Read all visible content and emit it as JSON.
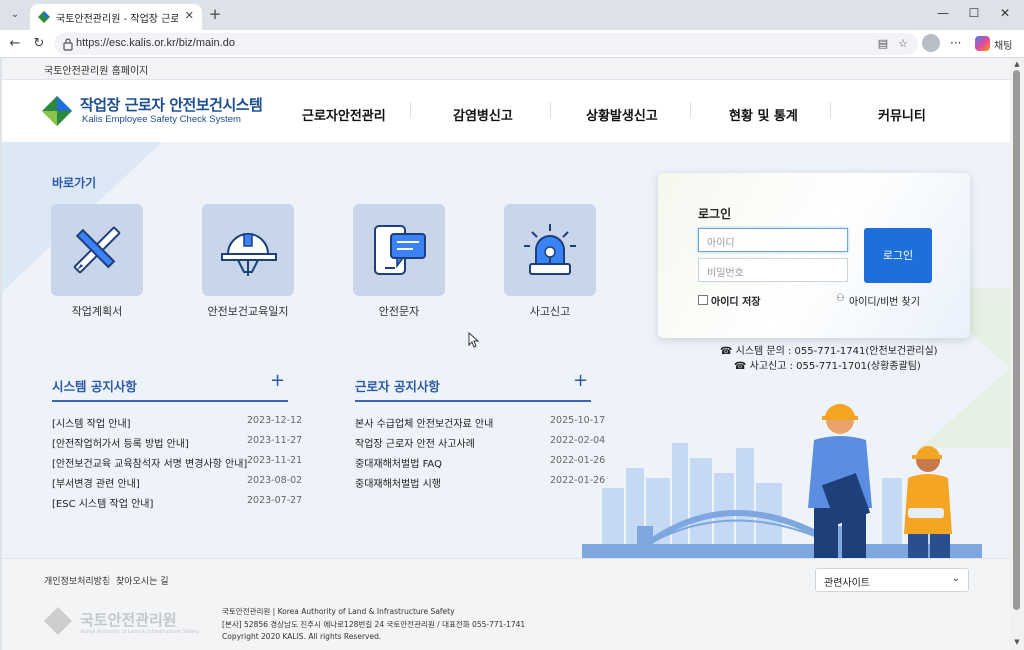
{
  "browser": {
    "tab_title": "국토안전관리원 - 작업장 근로자 안전보건시스템",
    "url": "https://esc.kalis.or.kr/biz/main.do",
    "chat_label": "채팅"
  },
  "site": {
    "top_link": "국토안전관리원 홈페이지",
    "logo_title": "작업장 근로자 안전보건시스템",
    "logo_subtitle": "Kalis Employee Safety Check System",
    "nav": [
      "근로자안전관리",
      "감염병신고",
      "상황발생신고",
      "현황 및 통계",
      "커뮤니티"
    ]
  },
  "quick_links": {
    "title": "바로가기",
    "items": [
      {
        "label": "작업계획서",
        "icon": "pencil-ruler-icon"
      },
      {
        "label": "안전보건교육일지",
        "icon": "hardhat-icon"
      },
      {
        "label": "안전문자",
        "icon": "phone-message-icon"
      },
      {
        "label": "사고신고",
        "icon": "siren-icon"
      }
    ]
  },
  "login": {
    "title": "로그인",
    "id_placeholder": "아이디",
    "pw_placeholder": "비밀번호",
    "button": "로그인",
    "save_id": "아이디 저장",
    "find": "아이디/비번 찾기"
  },
  "contacts": {
    "system": "☎ 시스템 문의 : 055-771-1741(안전보건관리실)",
    "accident": "☎ 사고신고 : 055-771-1701(상황종괄팀)"
  },
  "notices": {
    "system": {
      "title": "시스템 공지사항",
      "items": [
        {
          "title": "[시스템 작업 안내]",
          "date": "2023-12-12"
        },
        {
          "title": "[안전작업허가서 등록 방법 안내]",
          "date": "2023-11-27"
        },
        {
          "title": "[안전보건교육 교육참석자 서명 변경사항 안내]",
          "date": "2023-11-21"
        },
        {
          "title": "[부서변경 관련 안내]",
          "date": "2023-08-02"
        },
        {
          "title": "[ESC 시스템 작업 안내]",
          "date": "2023-07-27"
        }
      ]
    },
    "worker": {
      "title": "근로자 공지사항",
      "items": [
        {
          "title": "본사 수급업체 안전보건자료 안내",
          "date": "2025-10-17"
        },
        {
          "title": "작업장 근로자 안전 사고사례",
          "date": "2022-02-04"
        },
        {
          "title": "중대재해처벌법 FAQ",
          "date": "2022-01-26"
        },
        {
          "title": "중대재해처벌법 시행",
          "date": "2022-01-26"
        }
      ]
    }
  },
  "footer": {
    "links": [
      "개인정보처리방침",
      "찾아오시는 길"
    ],
    "related_select": "관련사이트",
    "logo_name": "국토안전관리원",
    "logo_sub": "Korea Authority of Land & Infrastructure Safety",
    "info": [
      "국토안전관리원 | Korea Authority of Land & Infrastructure Safety",
      "[본사] 52856 경상남도 진주시 에나로128번길 24 국토안전관리원 / 대표전화 055-771-1741",
      "Copyright 2020 KALIS. All rights Reserved."
    ]
  },
  "colors": {
    "brand_blue": "#1d4e8f",
    "accent_blue": "#1e6fd9",
    "section_blue": "#2a5aa6"
  }
}
